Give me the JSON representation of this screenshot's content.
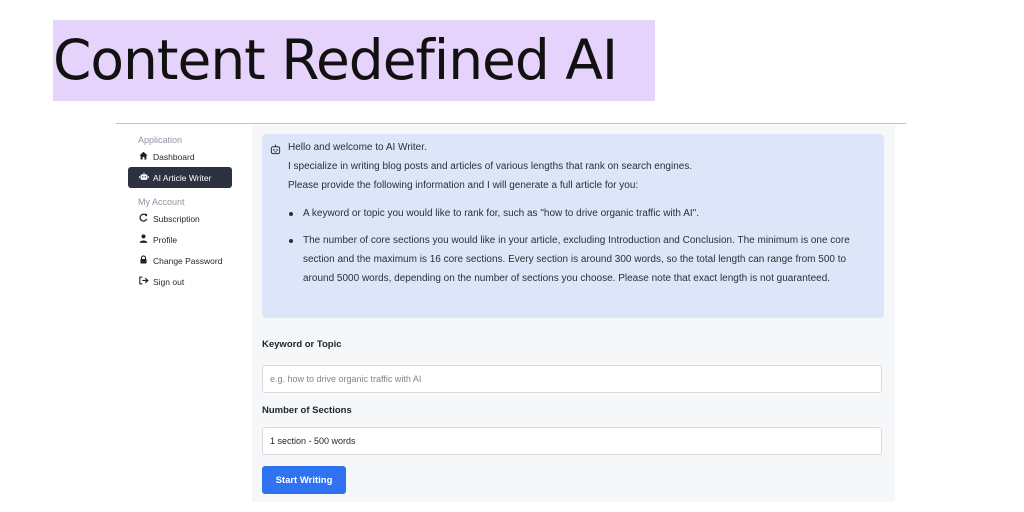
{
  "hero": {
    "title": "Content Redefined AI"
  },
  "sidebar": {
    "sections": [
      {
        "heading": "Application",
        "items": [
          {
            "label": "Dashboard",
            "icon": "home-icon"
          },
          {
            "label": "AI Article Writer",
            "icon": "robot-icon",
            "active": true
          }
        ]
      },
      {
        "heading": "My Account",
        "items": [
          {
            "label": "Subscription",
            "icon": "refresh-icon"
          },
          {
            "label": "Profile",
            "icon": "user-icon"
          },
          {
            "label": "Change Password",
            "icon": "lock-icon"
          },
          {
            "label": "Sign out",
            "icon": "sign-out-icon"
          }
        ]
      }
    ]
  },
  "intro": {
    "greeting": "Hello and welcome to AI Writer.",
    "line2": "I specialize in writing blog posts and articles of various lengths that rank on search engines.",
    "line3": "Please provide the following information and I will generate a full article for you:",
    "bullets": [
      "A keyword or topic you would like to rank for, such as \"how to drive organic traffic with AI\".",
      "The number of core sections you would like in your article, excluding Introduction and Conclusion. The minimum is one core section and the maximum is 16 core sections. Every section is around 300 words, so the total length can range from 500 to around 5000 words, depending on the number of sections you choose. Please note that exact length is not guaranteed."
    ]
  },
  "form": {
    "keyword_label": "Keyword or Topic",
    "keyword_placeholder": "e.g. how to drive organic traffic with AI",
    "keyword_value": "",
    "sections_label": "Number of Sections",
    "sections_value": "1 section - 500 words",
    "submit_label": "Start Writing"
  },
  "colors": {
    "hero_highlight": "#e6d3fb",
    "active_nav": "#2d3240",
    "info_box": "#dce6f8",
    "primary_button": "#2f73f2"
  }
}
